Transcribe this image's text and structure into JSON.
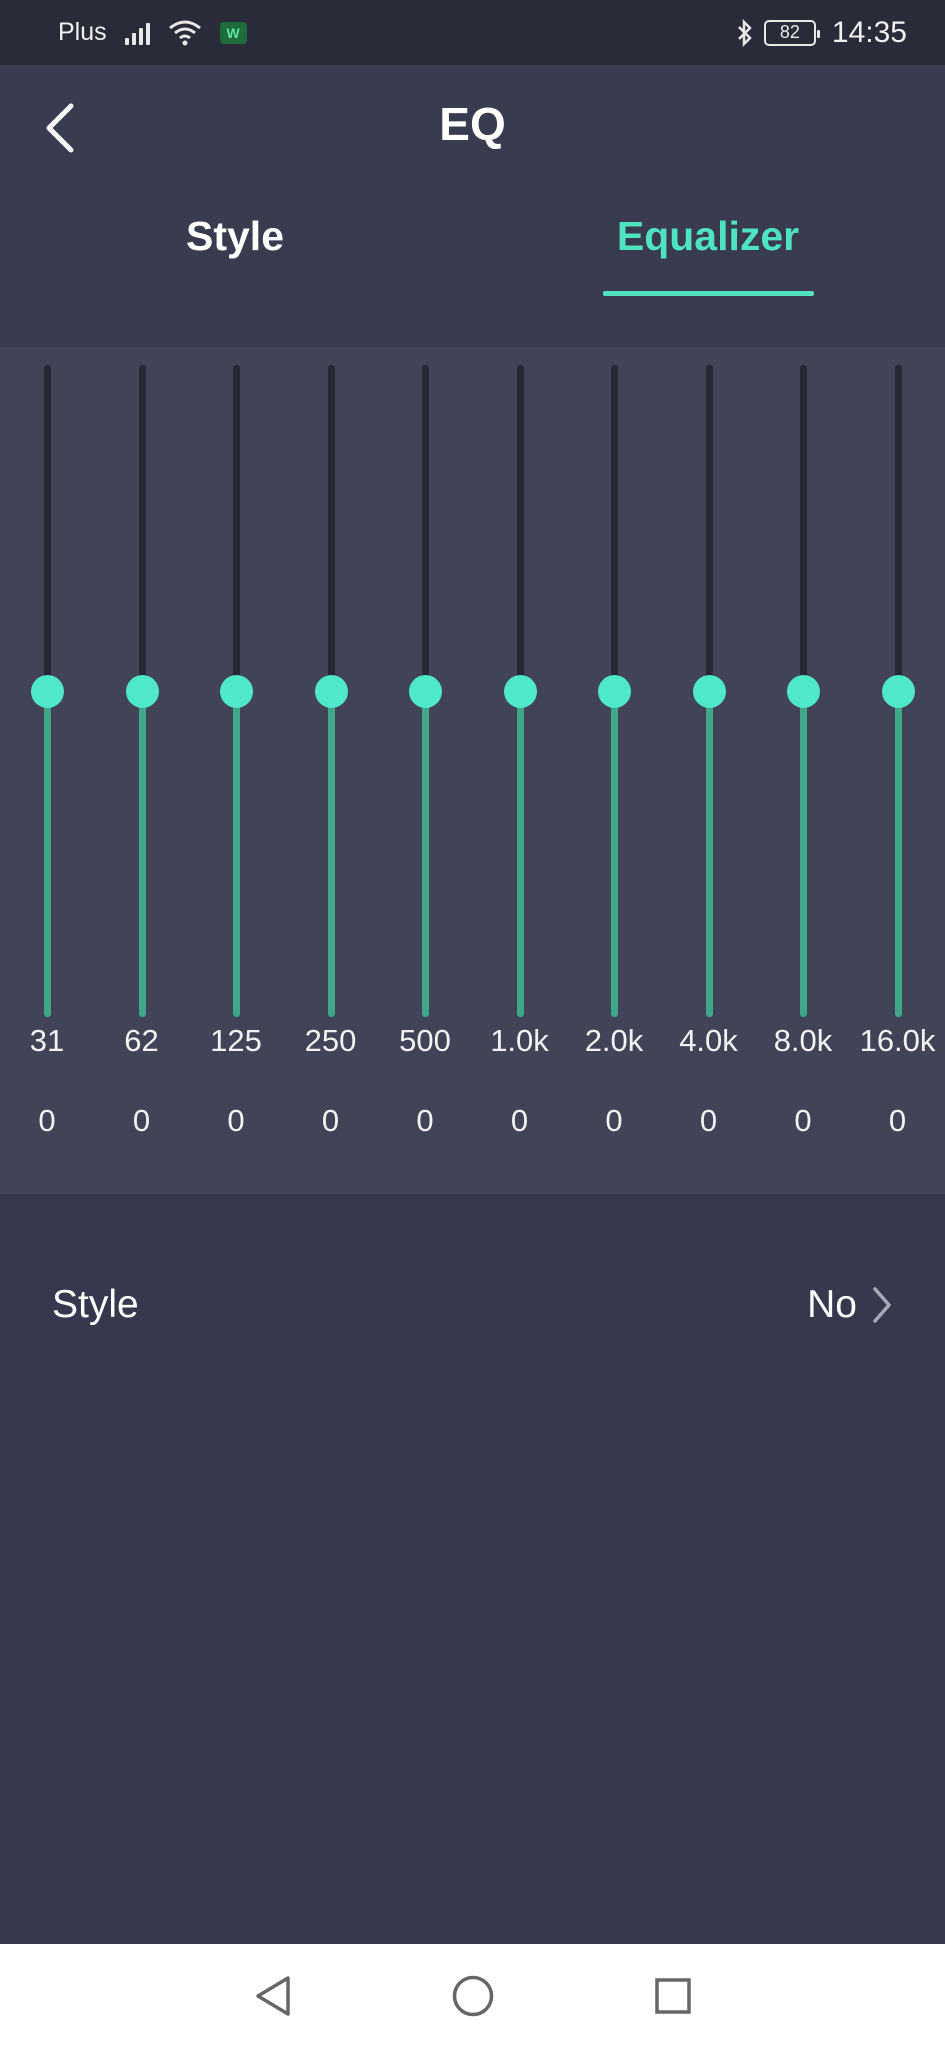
{
  "status_bar": {
    "carrier": "Plus",
    "app_badge": "W",
    "battery_level": "82",
    "time": "14:35",
    "icons": [
      "signal-icon",
      "wifi-icon",
      "app-notification-icon",
      "bluetooth-icon",
      "battery-icon"
    ]
  },
  "header": {
    "title": "EQ",
    "tabs": [
      {
        "label": "Style",
        "active": false
      },
      {
        "label": "Equalizer",
        "active": true
      }
    ],
    "accent_color": "#4fe3c1"
  },
  "equalizer": {
    "bands": [
      {
        "freq": "31",
        "gain": "0",
        "level": 0.5
      },
      {
        "freq": "62",
        "gain": "0",
        "level": 0.5
      },
      {
        "freq": "125",
        "gain": "0",
        "level": 0.5
      },
      {
        "freq": "250",
        "gain": "0",
        "level": 0.5
      },
      {
        "freq": "500",
        "gain": "0",
        "level": 0.5
      },
      {
        "freq": "1.0k",
        "gain": "0",
        "level": 0.5
      },
      {
        "freq": "2.0k",
        "gain": "0",
        "level": 0.5
      },
      {
        "freq": "4.0k",
        "gain": "0",
        "level": 0.5
      },
      {
        "freq": "8.0k",
        "gain": "0",
        "level": 0.5
      },
      {
        "freq": "16.0k",
        "gain": "0",
        "level": 0.5
      }
    ]
  },
  "style_row": {
    "label": "Style",
    "value": "No"
  },
  "nav_bar": {
    "icons": [
      "back-triangle-icon",
      "home-circle-icon",
      "recents-square-icon"
    ]
  }
}
